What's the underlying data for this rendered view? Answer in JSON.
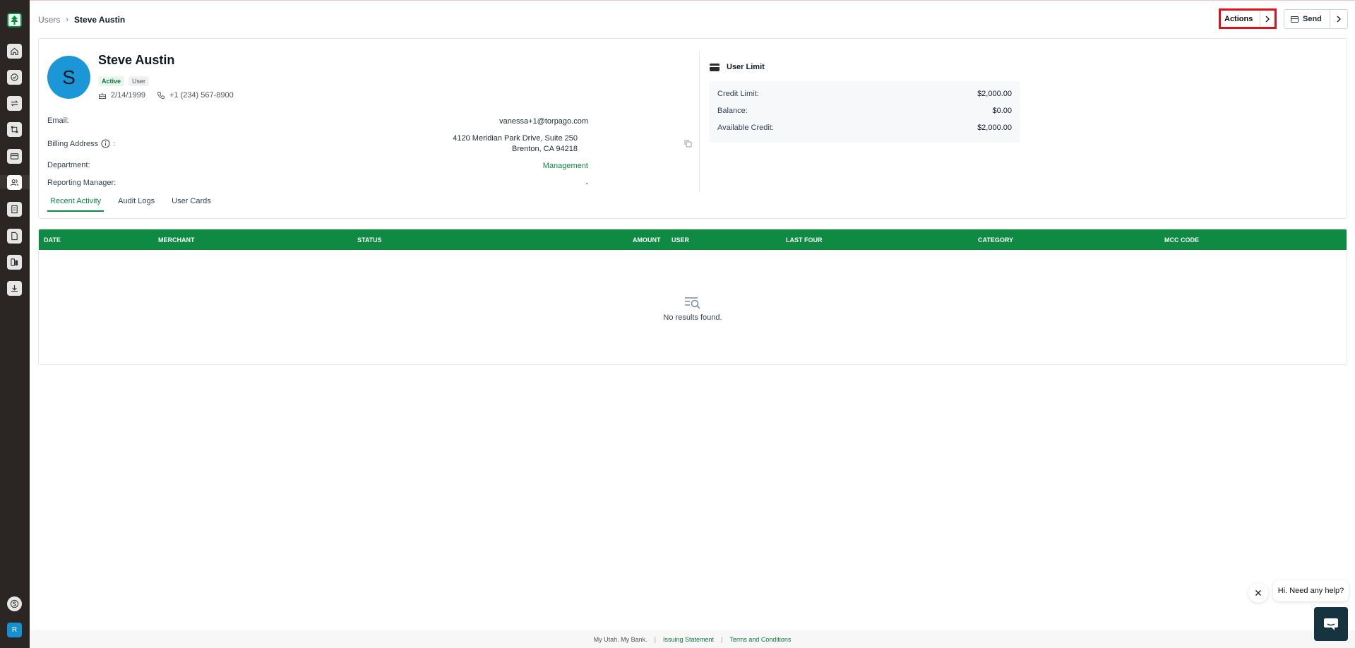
{
  "breadcrumb": {
    "parent": "Users",
    "current": "Steve Austin"
  },
  "header": {
    "actions_label": "Actions",
    "send_label": "Send"
  },
  "profile": {
    "avatar_initial": "S",
    "name": "Steve Austin",
    "status_badge": "Active",
    "role_badge": "User",
    "birthdate": "2/14/1999",
    "phone": "+1 (234) 567-8900",
    "email_label": "Email:",
    "email_value": "vanessa+1@torpago.com",
    "billing_label": "Billing Address",
    "billing_colon": ":",
    "billing_line1": "4120 Meridian Park Drive, Suite 250",
    "billing_line2": "Brenton, CA 94218",
    "department_label": "Department:",
    "department_value": "Management",
    "manager_label": "Reporting Manager:",
    "manager_value": "-"
  },
  "user_limit": {
    "title": "User Limit",
    "rows": [
      {
        "label": "Credit Limit:",
        "value": "$2,000.00"
      },
      {
        "label": "Balance:",
        "value": "$0.00"
      },
      {
        "label": "Available Credit:",
        "value": "$2,000.00"
      }
    ]
  },
  "tabs": [
    {
      "label": "Recent Activity",
      "active": true
    },
    {
      "label": "Audit Logs",
      "active": false
    },
    {
      "label": "User Cards",
      "active": false
    }
  ],
  "table": {
    "columns": [
      "DATE",
      "MERCHANT",
      "STATUS",
      "AMOUNT",
      "USER",
      "LAST FOUR",
      "CATEGORY",
      "MCC CODE"
    ],
    "empty_message": "No results found."
  },
  "footer": {
    "tagline": "My Utah. My Bank.",
    "link1": "Issuing Statement",
    "link2": "Terms and Conditions"
  },
  "help": {
    "bubble_text": "Hi. Need any help?"
  },
  "sidebar": {
    "avatar_initial": "R",
    "icons": [
      "home-icon",
      "tasks-icon",
      "transfer-icon",
      "workflow-icon",
      "card-icon",
      "users-icon",
      "ledger-icon",
      "document-icon",
      "bank-icon",
      "download-icon",
      "dollar-icon"
    ]
  },
  "colors": {
    "brand_green": "#0e8a43",
    "sidebar_bg": "#2b2623",
    "avatar_blue": "#1b96d6",
    "highlight_red": "#e1101a"
  }
}
